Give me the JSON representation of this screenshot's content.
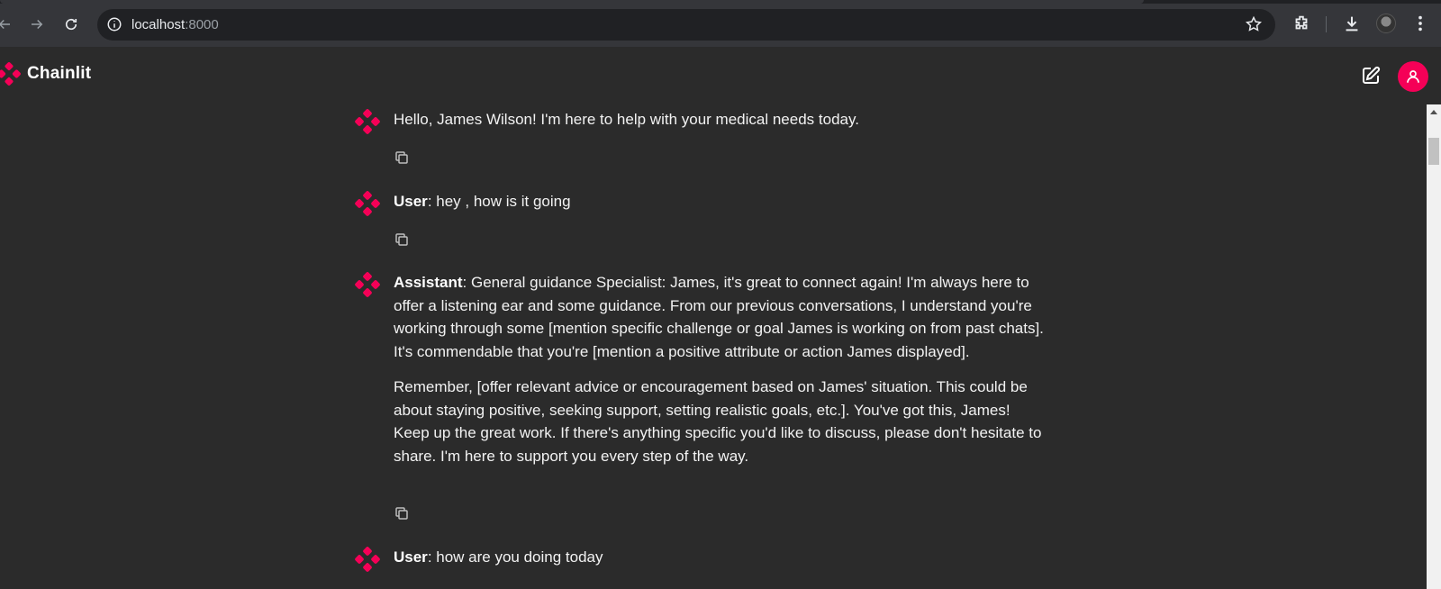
{
  "browser": {
    "url_host": "localhost",
    "url_port": ":8000"
  },
  "app": {
    "brand_name": "Chainlit",
    "brand_color": "#f50057"
  },
  "messages": [
    {
      "author": "",
      "text": "Hello, James Wilson! I'm here to help with your medical needs today."
    },
    {
      "author": "User",
      "text": ": hey , how is  it going"
    },
    {
      "author": "Assistant",
      "paragraphs": [
        ": General guidance Specialist: James, it's great to connect again! I'm always here to offer a listening ear and some guidance.  From our previous conversations, I understand you're working through some [mention specific challenge or goal James is working on from past chats]. It's commendable that you're [mention a positive attribute or action James displayed].",
        "Remember, [offer relevant advice or encouragement based on James' situation. This could be about staying positive, seeking support, setting realistic goals, etc.]. You've got this, James!  Keep up the great work.  If there's anything specific you'd like to discuss, please don't hesitate to share. I'm here to support you every step of the way."
      ]
    },
    {
      "author": "User",
      "text": ": how are you doing today"
    }
  ]
}
